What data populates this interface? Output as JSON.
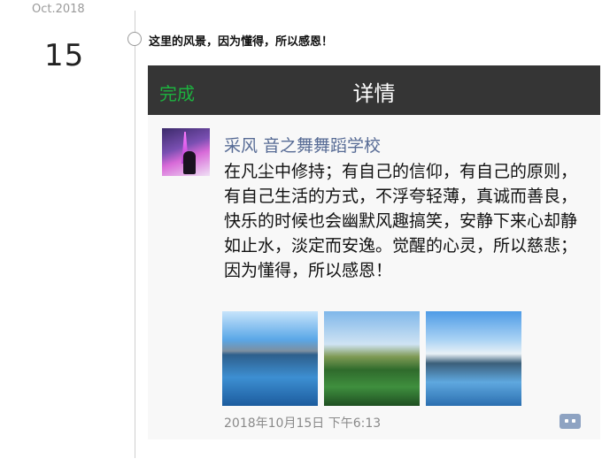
{
  "timeline": {
    "month": "Oct.2018",
    "day": "15",
    "caption": "这里的风景，因为懂得，所以感恩！"
  },
  "screenshot": {
    "navbar": {
      "done_label": "完成",
      "title": "详情"
    },
    "post": {
      "author": "采风 音之舞舞蹈学校",
      "body": "在凡尘中修持；有自己的信仰，有自己的原则，有自己生活的方式，不浮夸轻薄，真诚而善良，快乐的时候也会幽默风趣搞笑，安静下来心却静如止水，淡定而安逸。觉醒的心灵，所以慈悲；因为懂得，所以感恩！",
      "photos": [
        "lake-landscape-photo",
        "lotus-pond-photo",
        "lakeshore-reflection-photo"
      ],
      "timestamp": "2018年10月15日 下午6:13",
      "comment_icon": "comment-icon"
    }
  },
  "colors": {
    "navbar_bg": "#353535",
    "done_green": "#1db13f",
    "author_blue": "#576b95"
  }
}
